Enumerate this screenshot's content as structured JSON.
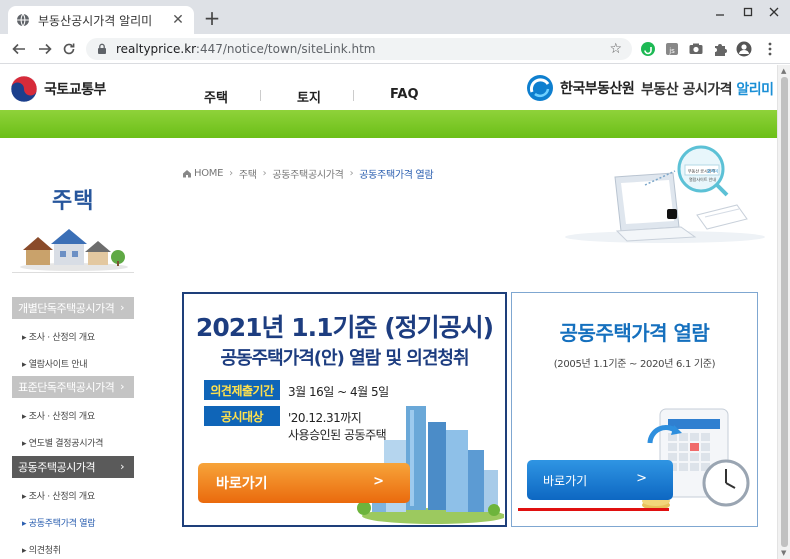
{
  "browser": {
    "tab_title": "부동산공시가격 알리미",
    "url_host": "realtyprice.kr",
    "url_rest": ":447/notice/town/siteLink.htm",
    "new_tab": "+",
    "tab_close": "✕"
  },
  "header": {
    "ministry_name": "국토교통부",
    "nav": [
      "주택",
      "토지",
      "FAQ"
    ],
    "agency_name": "한국부동산원",
    "service_name_1": "부동산 공시가격",
    "service_name_2": "알리미"
  },
  "sidebar": {
    "title": "주택",
    "sections": [
      {
        "label": "개별단독주택공시가격",
        "items": [
          "조사 · 산정의 개요",
          "열람사이트 안내"
        ]
      },
      {
        "label": "표준단독주택공시가격",
        "items": [
          "조사 · 산정의 개요",
          "연도별 결정공시가격"
        ]
      },
      {
        "label": "공동주택공시가격",
        "items": [
          "조사 · 산정의 개요",
          "공동주택가격 열람",
          "의견청취"
        ]
      }
    ],
    "active_item": "공동주택가격 열람"
  },
  "breadcrumb": {
    "home": "HOME",
    "items": [
      "주택",
      "공동주택공시가격"
    ],
    "current": "공동주택가격 열람"
  },
  "notice_box": {
    "title": "2021년 1.1기준 (정기공시)",
    "subtitle": "공동주택가격(안) 열람 및 의견청취",
    "period_label": "의견제출기간",
    "period_value": "3월 16일 ~ 4월 5일",
    "target_label": "공시대상",
    "target_line1": "'20.12.31까지",
    "target_line2": "사용승인된 공동주택",
    "button": "바로가기"
  },
  "archive_box": {
    "title": "공동주택가격 열람",
    "range": "(2005년 1.1기준 ~ 2020년 6.1 기준)",
    "button": "바로가기"
  },
  "illustration": {
    "laptop_text_1": "부동산 공시가격",
    "laptop_text_2": "알리미",
    "laptop_text_3": "열람사이트 안내"
  },
  "colors": {
    "brand_blue": "#1d3d80",
    "accent_green": "#6bbf17",
    "button_orange": "#ea6a0d",
    "button_blue": "#0d67c2",
    "highlight_red": "#e01010"
  }
}
